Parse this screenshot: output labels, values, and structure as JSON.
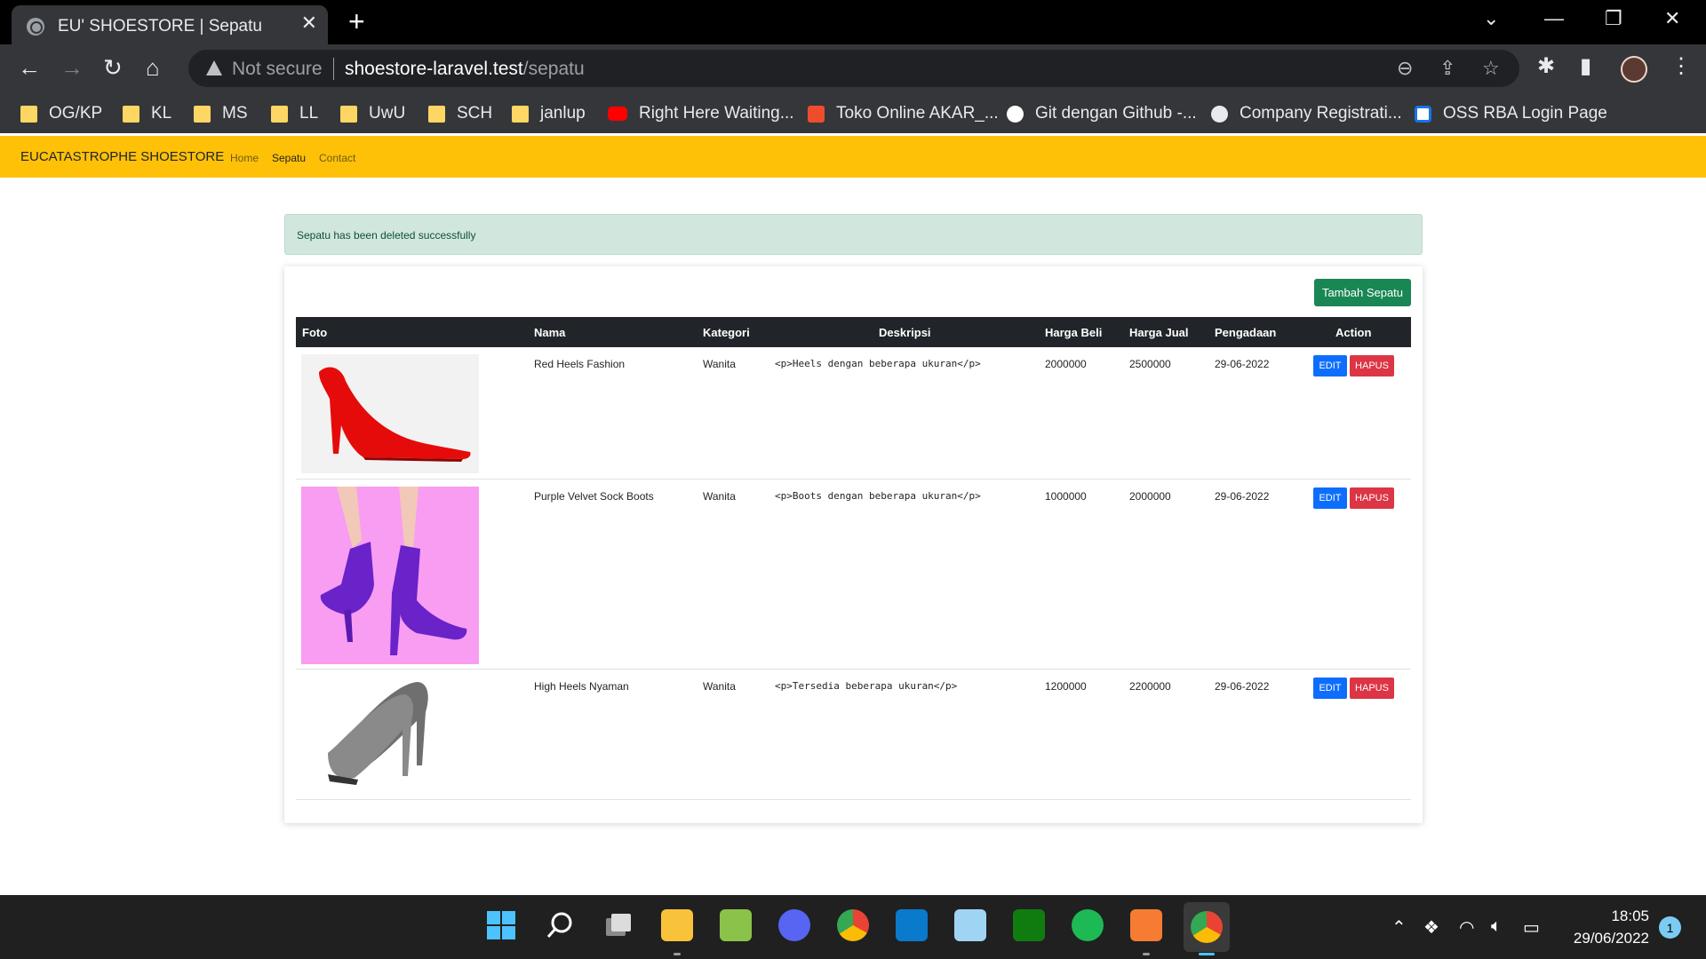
{
  "browser": {
    "tab_title": "EU' SHOESTORE | Sepatu",
    "tab_close": "✕",
    "new_tab": "+",
    "not_secure": "Not secure",
    "url_host": "shoestore-laravel.test",
    "url_path": "/sepatu",
    "bookmarks": [
      {
        "label": "OG/KP",
        "icon": "folder-icon"
      },
      {
        "label": "KL",
        "icon": "folder-icon"
      },
      {
        "label": "MS",
        "icon": "folder-icon"
      },
      {
        "label": "LL",
        "icon": "folder-icon"
      },
      {
        "label": "UwU",
        "icon": "folder-icon"
      },
      {
        "label": "SCH",
        "icon": "folder-icon"
      },
      {
        "label": "janlup",
        "icon": "folder-icon"
      },
      {
        "label": "Right Here Waiting...",
        "icon": "youtube-icon"
      },
      {
        "label": "Toko Online AKAR_...",
        "icon": "shopee-icon"
      },
      {
        "label": "Git dengan Github -...",
        "icon": "github-icon"
      },
      {
        "label": "Company Registrati...",
        "icon": "globe-icon"
      },
      {
        "label": "OSS RBA Login Page",
        "icon": "oss-icon"
      }
    ]
  },
  "navbar": {
    "brand": "EUCATASTROPHE SHOESTORE",
    "links": [
      "Home",
      "Sepatu",
      "Contact"
    ],
    "active": "Sepatu"
  },
  "alert": {
    "message": "Sepatu has been deleted successfully"
  },
  "table": {
    "add_button": "Tambah Sepatu",
    "headers": [
      "Foto",
      "Nama",
      "Kategori",
      "Deskripsi",
      "Harga Beli",
      "Harga Jual",
      "Pengadaan",
      "Action"
    ],
    "edit_label": "EDIT",
    "delete_label": "HAPUS",
    "rows": [
      {
        "nama": "Red Heels Fashion",
        "kategori": "Wanita",
        "deskripsi": "<p>Heels dengan beberapa ukuran</p>",
        "harga_beli": "2000000",
        "harga_jual": "2500000",
        "pengadaan": "29-06-2022"
      },
      {
        "nama": "Purple Velvet Sock Boots",
        "kategori": "Wanita",
        "deskripsi": "<p>Boots dengan beberapa ukuran</p>",
        "harga_beli": "1000000",
        "harga_jual": "2000000",
        "pengadaan": "29-06-2022"
      },
      {
        "nama": "High Heels Nyaman",
        "kategori": "Wanita",
        "deskripsi": "<p>Tersedia beberapa ukuran</p>",
        "harga_beli": "1200000",
        "harga_jual": "2200000",
        "pengadaan": "29-06-2022"
      }
    ]
  },
  "taskbar": {
    "time": "18:05",
    "date": "29/06/2022",
    "notifications": "1"
  },
  "colors": {
    "navbar": "#ffc107",
    "alert_bg": "#d1e7dd",
    "add_button": "#198754",
    "edit_button": "#0d6efd",
    "delete_button": "#dc3545",
    "table_header": "#212529"
  }
}
